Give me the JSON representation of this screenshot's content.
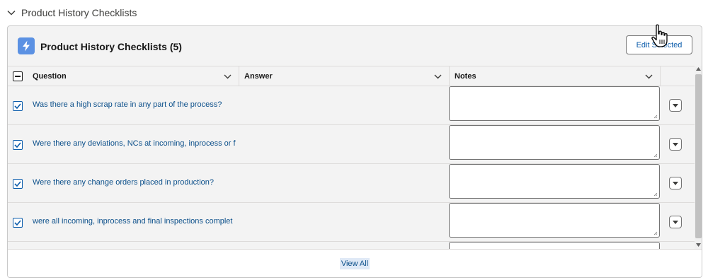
{
  "section": {
    "title": "Product History Checklists",
    "icon": "chevron-down-icon"
  },
  "card": {
    "title": "Product History Checklists (5)",
    "icon": "lightning-bolt-icon",
    "icon_color": "#5b91e3",
    "edit_button_label": "Edit Selected"
  },
  "table": {
    "columns": [
      {
        "label": "Question"
      },
      {
        "label": "Answer"
      },
      {
        "label": "Notes"
      }
    ],
    "rows": [
      {
        "question": "Was there a high scrap rate in any part of the process?",
        "answer": "",
        "notes": "",
        "selected": true
      },
      {
        "question": "Were there any deviations, NCs at incoming, inprocess or f",
        "answer": "",
        "notes": "",
        "selected": true
      },
      {
        "question": "Were there any change orders placed in production?",
        "answer": "",
        "notes": "",
        "selected": true
      },
      {
        "question": "were all incoming, inprocess and final inspections complet",
        "answer": "",
        "notes": "",
        "selected": true
      }
    ]
  },
  "footer": {
    "view_all_label": "View All"
  },
  "colors": {
    "link": "#0b4f8a",
    "button_text": "#0b5cab",
    "card_bg": "#f3f3f3",
    "border": "#c9c9c9"
  }
}
